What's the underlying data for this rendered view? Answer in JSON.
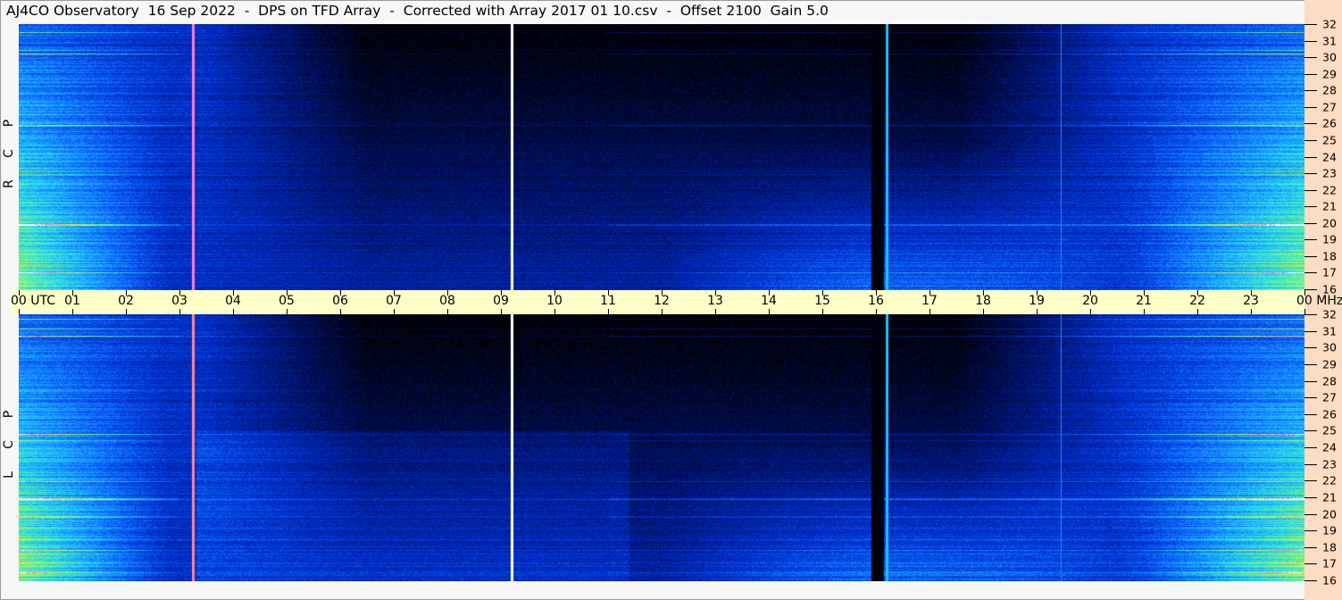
{
  "title": "AJ4CO Observatory  16 Sep 2022  -  DPS on TFD Array  -  Corrected with Array 2017 01 10.csv  -  Offset 2100  Gain 5.0",
  "chart_data": {
    "type": "heatmap",
    "title": "AJ4CO Observatory  16 Sep 2022  -  DPS on TFD Array  -  Corrected with Array 2017 01 10.csv  -  Offset 2100  Gain 5.0",
    "xlabel": "UTC",
    "ylabel": "MHz",
    "xlim": [
      0,
      24
    ],
    "ylim": [
      16,
      32
    ],
    "x_ticks": [
      "00",
      "01",
      "02",
      "03",
      "04",
      "05",
      "06",
      "07",
      "08",
      "09",
      "10",
      "11",
      "12",
      "13",
      "14",
      "15",
      "16",
      "17",
      "18",
      "19",
      "20",
      "21",
      "22",
      "23",
      "00"
    ],
    "x_first_label": "00  UTC",
    "x_last_label": "00 MHz",
    "y_ticks": [
      "16",
      "17",
      "18",
      "19",
      "20",
      "21",
      "22",
      "23",
      "24",
      "25",
      "26",
      "27",
      "28",
      "29",
      "30",
      "31",
      "32"
    ],
    "panels": [
      {
        "name": "RCP",
        "letters": [
          "R",
          "C",
          "P"
        ]
      },
      {
        "name": "LCP",
        "letters": [
          "L",
          "C",
          "P"
        ]
      }
    ],
    "colormap": [
      "#000000",
      "#001060",
      "#0030d0",
      "#1070ff",
      "#20c0ff",
      "#40f0c0",
      "#a0f060",
      "#f0f040",
      "#ff60c0",
      "#ffffff"
    ],
    "vertical_markers_utc": [
      3.25,
      9.2,
      16.2,
      19.45
    ],
    "dark_band_utc": [
      15.9,
      16.15
    ]
  }
}
